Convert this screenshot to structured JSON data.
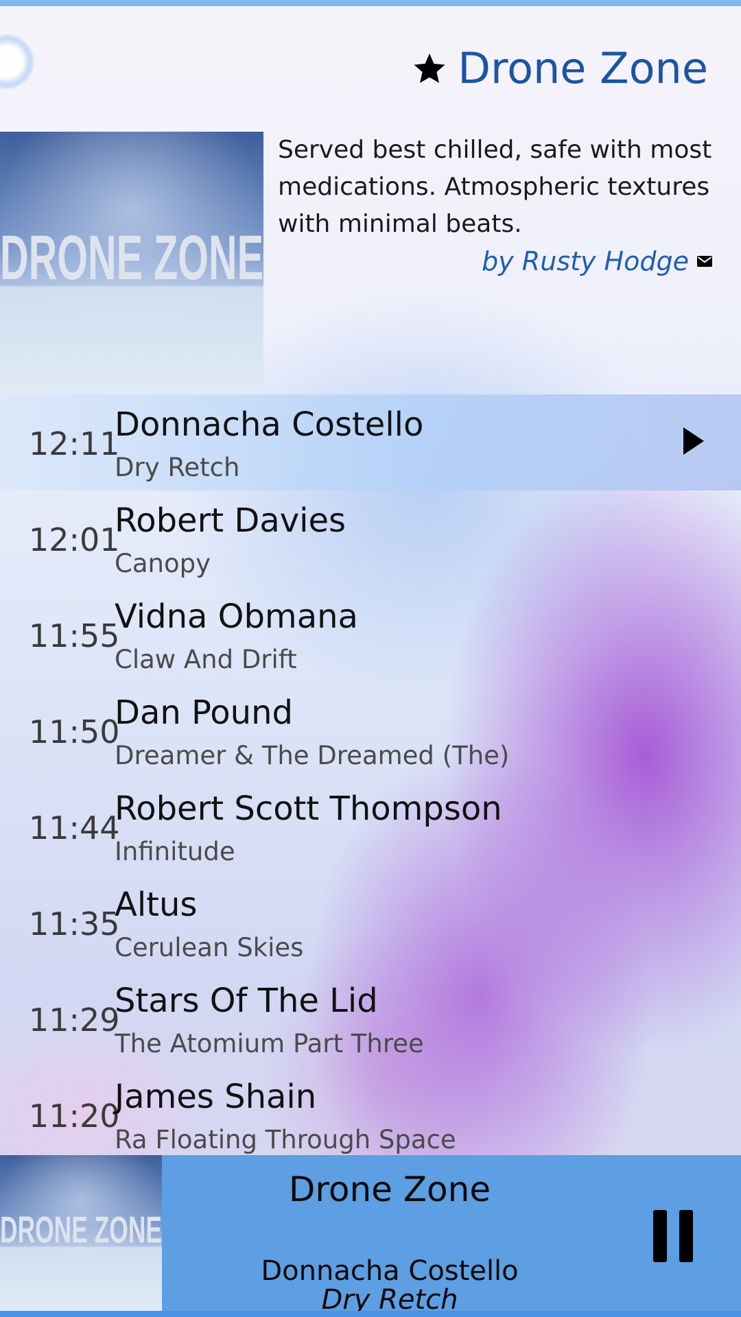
{
  "header": {
    "title": "Drone Zone",
    "favorite_icon": "star-icon"
  },
  "station": {
    "cover_text": "DRONE ZONE",
    "description": "Served best chilled, safe with most medications. Atmospheric textures with minimal beats.",
    "author": "by Rusty Hodge",
    "contact_icon": "mail-icon"
  },
  "tracks": [
    {
      "time": "12:11",
      "artist": "Donnacha Costello",
      "title": "Dry Retch",
      "current": true
    },
    {
      "time": "12:01",
      "artist": "Robert Davies",
      "title": "Canopy"
    },
    {
      "time": "11:55",
      "artist": "Vidna Obmana",
      "title": "Claw And Drift"
    },
    {
      "time": "11:50",
      "artist": "Dan Pound",
      "title": "Dreamer & The Dreamed (The)"
    },
    {
      "time": "11:44",
      "artist": "Robert Scott Thompson",
      "title": "Infinitude"
    },
    {
      "time": "11:35",
      "artist": "Altus",
      "title": "Cerulean Skies"
    },
    {
      "time": "11:29",
      "artist": "Stars Of The Lid",
      "title": "The Atomium Part Three"
    },
    {
      "time": "11:20",
      "artist": "James Shain",
      "title": "Ra Floating Through Space"
    }
  ],
  "player": {
    "station": "Drone Zone",
    "artist": "Donnacha Costello",
    "title": "Dry Retch",
    "state_icon": "pause-icon"
  },
  "colors": {
    "accent": "#1a55a6",
    "player_bar": "#5e9ee2",
    "top_strip": "#7eb6ef"
  }
}
